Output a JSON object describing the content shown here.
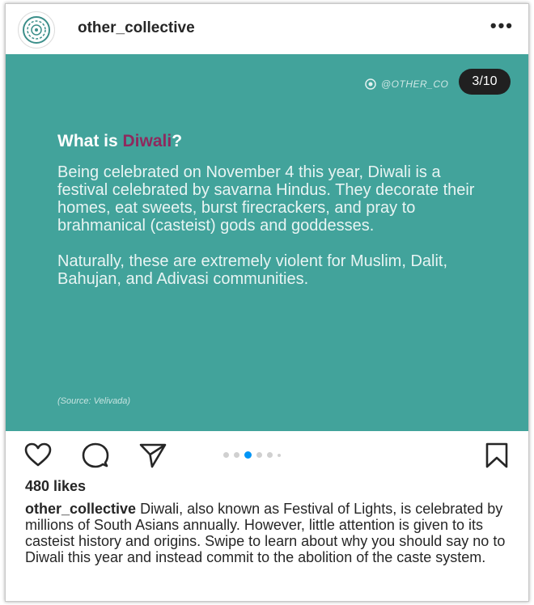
{
  "header": {
    "username": "other_collective",
    "more_label": "•••"
  },
  "post": {
    "watermark": "@OTHER_CO",
    "counter": "3/10",
    "title_prefix": "What is ",
    "title_accent": "Diwali",
    "title_suffix": "?",
    "paragraph_1": "Being celebrated on November 4 this year, Diwali is a festival celebrated by savarna Hindus. They decorate their homes, eat sweets, burst firecrackers, and pray to brahmanical (casteist) gods and goddesses.",
    "paragraph_2": "Naturally, these are extremely violent for Muslim, Dalit, Bahujan, and Adivasi communities.",
    "source": "(Source: Velivada)",
    "background_color": "#42a39b",
    "accent_color": "#8e2a5e"
  },
  "actions": {
    "icons": [
      "heart-icon",
      "comment-icon",
      "share-icon",
      "bookmark-icon"
    ],
    "carousel_total": 6,
    "carousel_active_index": 2,
    "active_dot_color": "#0095f6"
  },
  "likes": "480 likes",
  "caption": {
    "username": "other_collective",
    "text": "Diwali, also known as Festival of Lights, is celebrated by millions of South Asians annually. However, little attention is given to its casteist history and origins. Swipe to learn about why you should say no to Diwali this year and instead commit to the abolition of the caste system."
  }
}
